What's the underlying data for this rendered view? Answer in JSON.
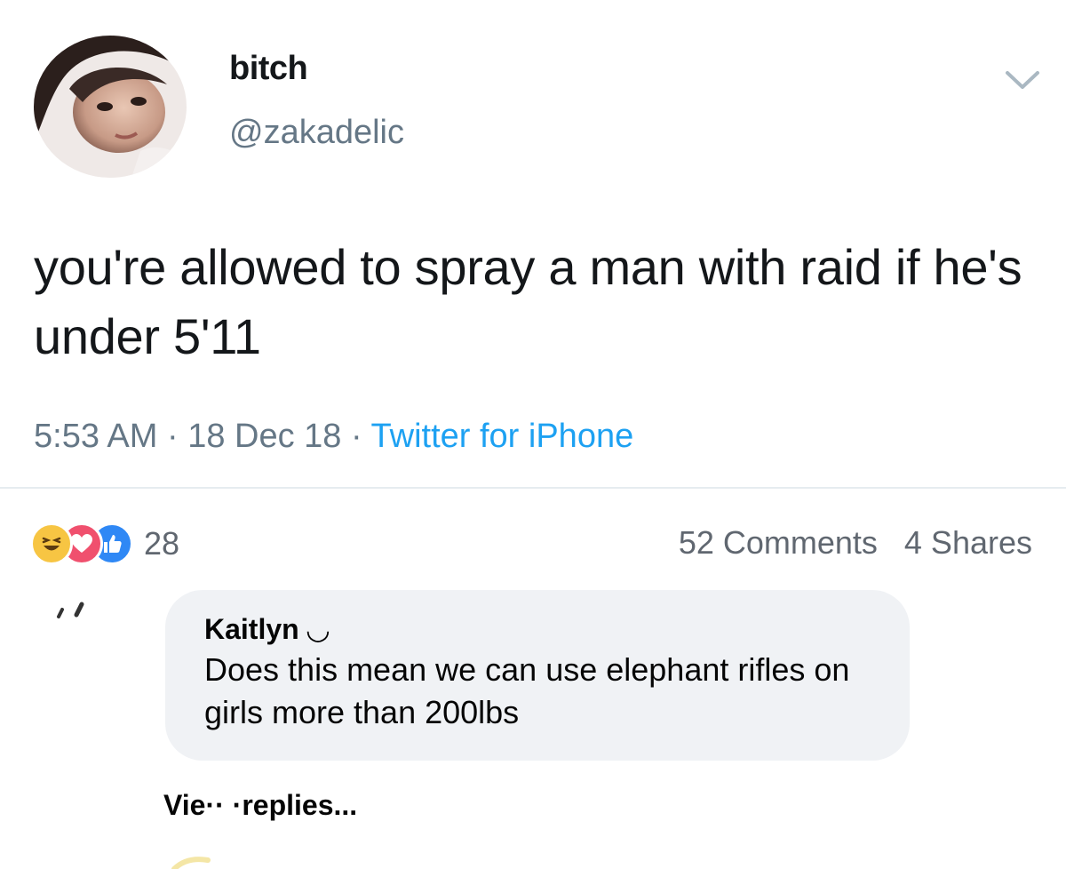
{
  "tweet": {
    "display_name": "bitch",
    "handle": "@zakadelic",
    "text": "you're allowed to spray a man with raid if he's under 5'11",
    "time": "5:53 AM",
    "separator": " · ",
    "date": "18 Dec 18",
    "source": "Twitter for iPhone",
    "menu_icon": "chevron-down-icon"
  },
  "facebook": {
    "reactions": [
      "haha",
      "love",
      "like"
    ],
    "reaction_count": "28",
    "comments": "52 Comments",
    "shares": "4 Shares",
    "comment": {
      "author": "Kaitlyn ◡",
      "text": "Does this mean we can use elephant rifles on girls more than 200lbs"
    },
    "view_replies": "Vie·· ·replies..."
  },
  "colors": {
    "handle_gray": "#657786",
    "twitter_blue": "#1da1f2",
    "bubble_gray": "#f0f2f5",
    "haha_yellow": "#f7c543",
    "love_red": "#f0506e",
    "like_blue": "#2f88f5"
  }
}
